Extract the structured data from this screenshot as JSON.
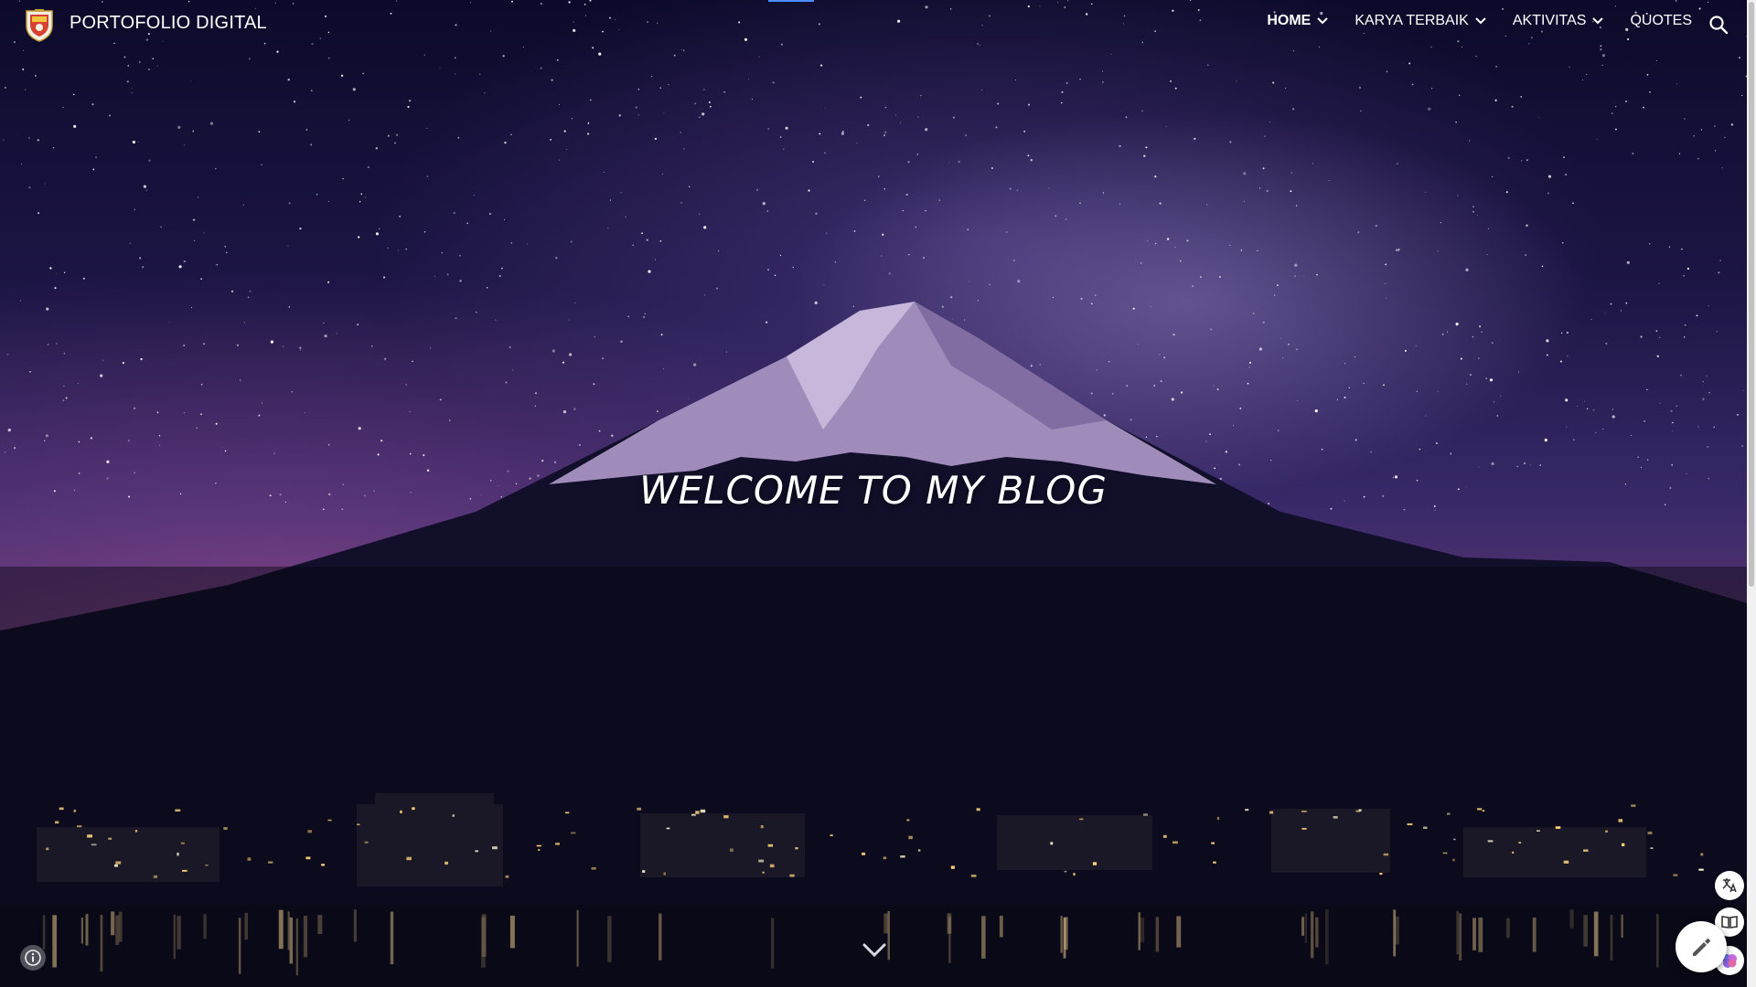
{
  "site": {
    "title": "PORTOFOLIO DIGITAL"
  },
  "nav": {
    "items": [
      {
        "label": "HOME",
        "has_dropdown": true,
        "active": true
      },
      {
        "label": "KARYA TERBAIK",
        "has_dropdown": true,
        "active": false
      },
      {
        "label": "AKTIVITAS",
        "has_dropdown": true,
        "active": false
      },
      {
        "label": "QUOTES",
        "has_dropdown": false,
        "active": false
      }
    ],
    "search_icon": "search-icon"
  },
  "hero": {
    "heading": "WELCOME TO MY BLOG",
    "scroll_icon": "chevron-down-icon"
  },
  "floating_actions": {
    "edit_icon": "pencil-icon",
    "small_icons": [
      "translate-icon",
      "book-icon",
      "brain-icon"
    ],
    "info_icon": "info-icon"
  },
  "colors": {
    "text": "#ffffff",
    "accent": "#4d8cff"
  }
}
